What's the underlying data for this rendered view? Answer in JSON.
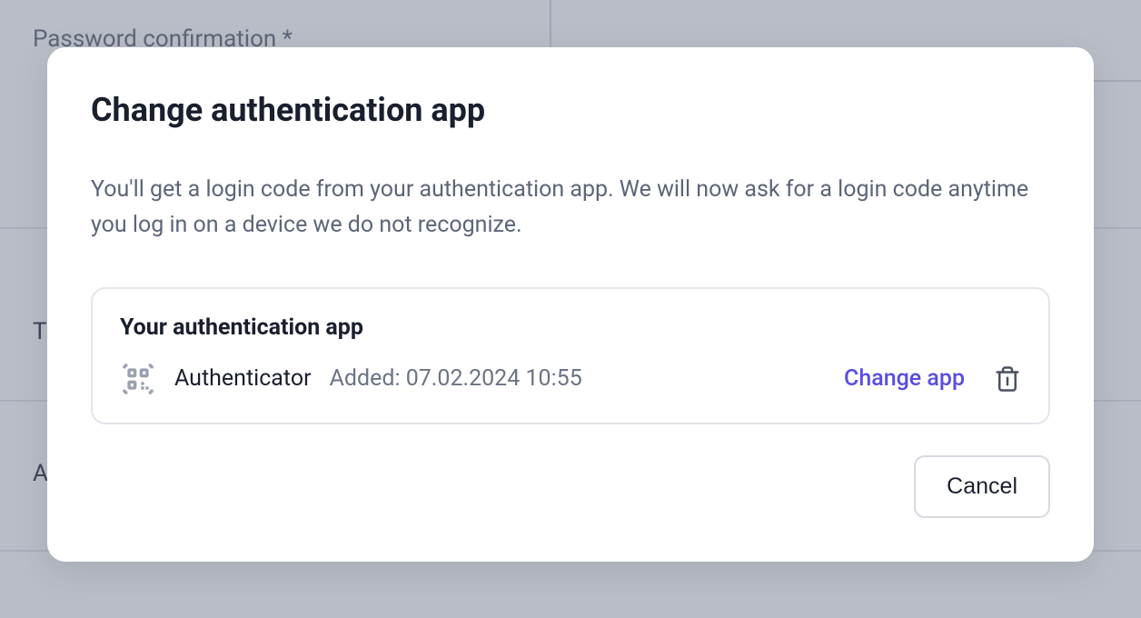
{
  "background": {
    "password_confirmation_label": "Password confirmation *",
    "truncated_t": "T",
    "truncated_a": "A"
  },
  "modal": {
    "title": "Change authentication app",
    "description": "You'll get a login code from your authentication app. We will now ask for a login code anytime you log in on a device we do not recognize.",
    "card_title": "Your authentication app",
    "app_name": "Authenticator",
    "app_added": "Added: 07.02.2024 10:55",
    "change_link": "Change app",
    "cancel_label": "Cancel"
  }
}
